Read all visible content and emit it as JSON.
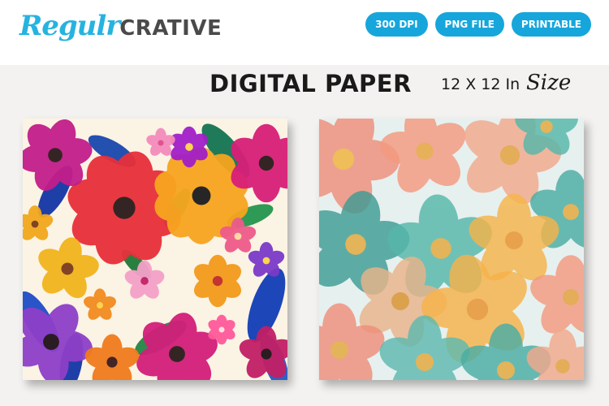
{
  "brand": {
    "script": "Regulr",
    "block": "CRATIVE"
  },
  "badges": [
    "300 DPI",
    "PNG FILE",
    "PRINTABLE"
  ],
  "title": "DIGITAL PAPER",
  "size": {
    "text": "12 X 12 In",
    "script": "Size"
  },
  "colors": {
    "accent": "#16a6dc",
    "logo_script": "#26b3e0",
    "logo_block": "#4a4a4a",
    "title": "#1a1a1a",
    "background": "#f3f2f0"
  },
  "previews": [
    {
      "name": "vibrant-floral-pattern"
    },
    {
      "name": "watercolor-pastel-floral-pattern"
    }
  ]
}
